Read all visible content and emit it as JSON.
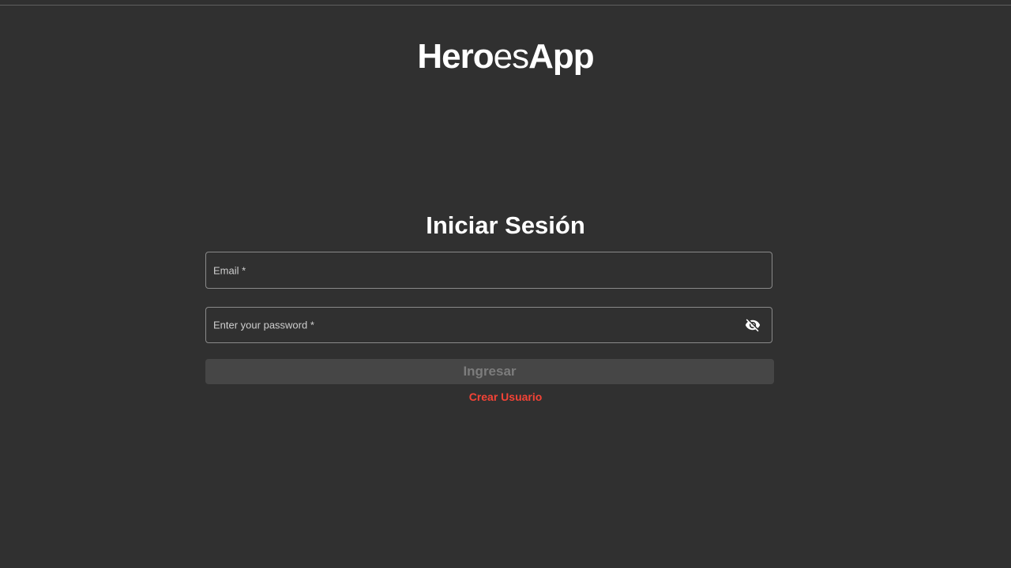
{
  "logo": {
    "part1": "Hero",
    "part2": "es",
    "part3": "App"
  },
  "login": {
    "title": "Iniciar Sesión",
    "email_label": "Email *",
    "email_value": "",
    "password_label": "Enter your password *",
    "password_value": "",
    "password_toggle_icon": "visibility-off-icon",
    "submit_label": "Ingresar",
    "create_user_label": "Crear Usuario"
  },
  "colors": {
    "background": "#303030",
    "accent_link": "#f44336",
    "button_disabled_bg": "#464646",
    "button_disabled_text": "#7c7c7c"
  }
}
